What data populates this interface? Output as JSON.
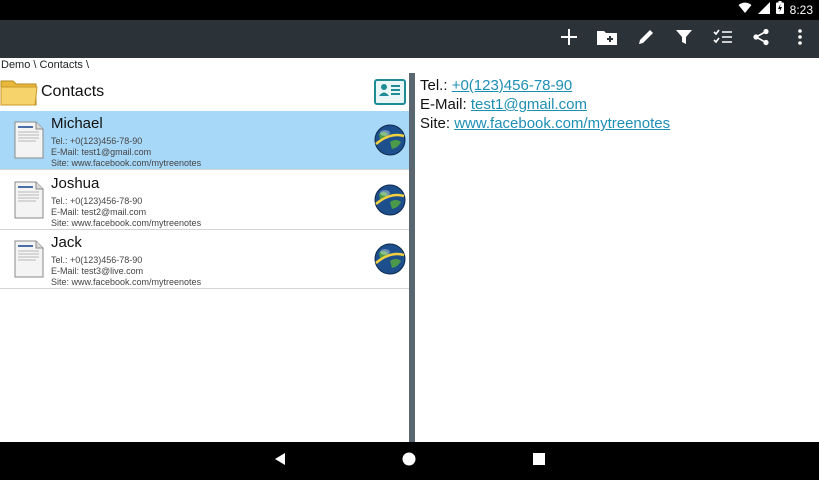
{
  "status": {
    "time": "8:23"
  },
  "toolbar": {
    "actions": [
      "add-icon",
      "add-folder-icon",
      "edit-icon",
      "filter-icon",
      "checklist-icon",
      "share-icon",
      "more-icon"
    ]
  },
  "breadcrumb": "Demo \\ Contacts \\",
  "folder": {
    "label": "Contacts"
  },
  "contacts": [
    {
      "name": "Michael",
      "tel": "Tel.: +0(123)456-78-90",
      "email": "E-Mail: test1@gmail.com",
      "site": "Site: www.facebook.com/mytreenotes"
    },
    {
      "name": "Joshua",
      "tel": "Tel.: +0(123)456-78-90",
      "email": "E-Mail: test2@mail.com",
      "site": "Site: www.facebook.com/mytreenotes"
    },
    {
      "name": "Jack",
      "tel": "Tel.: +0(123)456-78-90",
      "email": "E-Mail: test3@live.com",
      "site": "Site: www.facebook.com/mytreenotes"
    }
  ],
  "detail": {
    "tel_label": "Tel.:",
    "tel_value": "+0(123)456-78-90",
    "email_label": "E-Mail:",
    "email_value": "test1@gmail.com",
    "site_label": "Site:",
    "site_value": "www.facebook.com/mytreenotes"
  },
  "colors": {
    "toolbar": "#2c3338",
    "selected_row": "#a8d8f7",
    "link": "#1e8fb4",
    "accent": "#1e8c95"
  }
}
